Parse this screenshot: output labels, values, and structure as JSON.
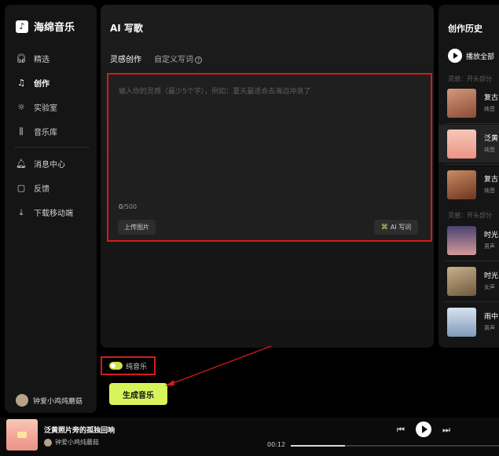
{
  "app": {
    "name": "海绵音乐"
  },
  "sidebar": {
    "items": [
      {
        "label": "精选",
        "icon": "headphones-icon"
      },
      {
        "label": "创作",
        "icon": "music-note-icon"
      },
      {
        "label": "实验室",
        "icon": "sun-icon"
      },
      {
        "label": "音乐库",
        "icon": "library-icon"
      }
    ],
    "bottom_items": [
      {
        "label": "消息中心",
        "icon": "bell-icon"
      },
      {
        "label": "反馈",
        "icon": "feedback-icon"
      },
      {
        "label": "下载移动端",
        "icon": "download-icon"
      }
    ],
    "user": {
      "name": "钟爱小鸡炖蘑菇"
    }
  },
  "main": {
    "title": "AI 写歌",
    "tabs": [
      {
        "label": "灵感创作"
      },
      {
        "label": "自定义写词"
      }
    ],
    "editor": {
      "placeholder": "输入你的灵感（最少5个字），例如：夏天最适合去海边冲浪了",
      "count_current": "0",
      "count_max": "/500"
    },
    "upload_label": "上传图片",
    "ai_lyrics_label": "AI 写词",
    "pure_music_label": "纯音乐",
    "pure_music_on": true,
    "generate_label": "生成音乐"
  },
  "history": {
    "title": "创作历史",
    "play_all_label": "播放全部",
    "group_label": "灵感：开头部分",
    "items": [
      {
        "name": "复古",
        "sub": "纯音",
        "color": "#b5715a"
      },
      {
        "name": "泛黄",
        "sub": "纯音",
        "color": "#f2a898"
      },
      {
        "name": "复古",
        "sub": "纯音",
        "color": "#a05a3c"
      },
      {
        "name": "时光",
        "sub": "男声",
        "color": "#7e6a8c"
      },
      {
        "name": "时光",
        "sub": "女声",
        "color": "#a89070"
      },
      {
        "name": "雨中",
        "sub": "男声",
        "color": "#8aa0b8"
      }
    ]
  },
  "player": {
    "title": "泛黄照片旁的孤独回响",
    "artist": "钟爱小鸡炖蘑菇",
    "time": "00:12",
    "progress": 0.26
  }
}
